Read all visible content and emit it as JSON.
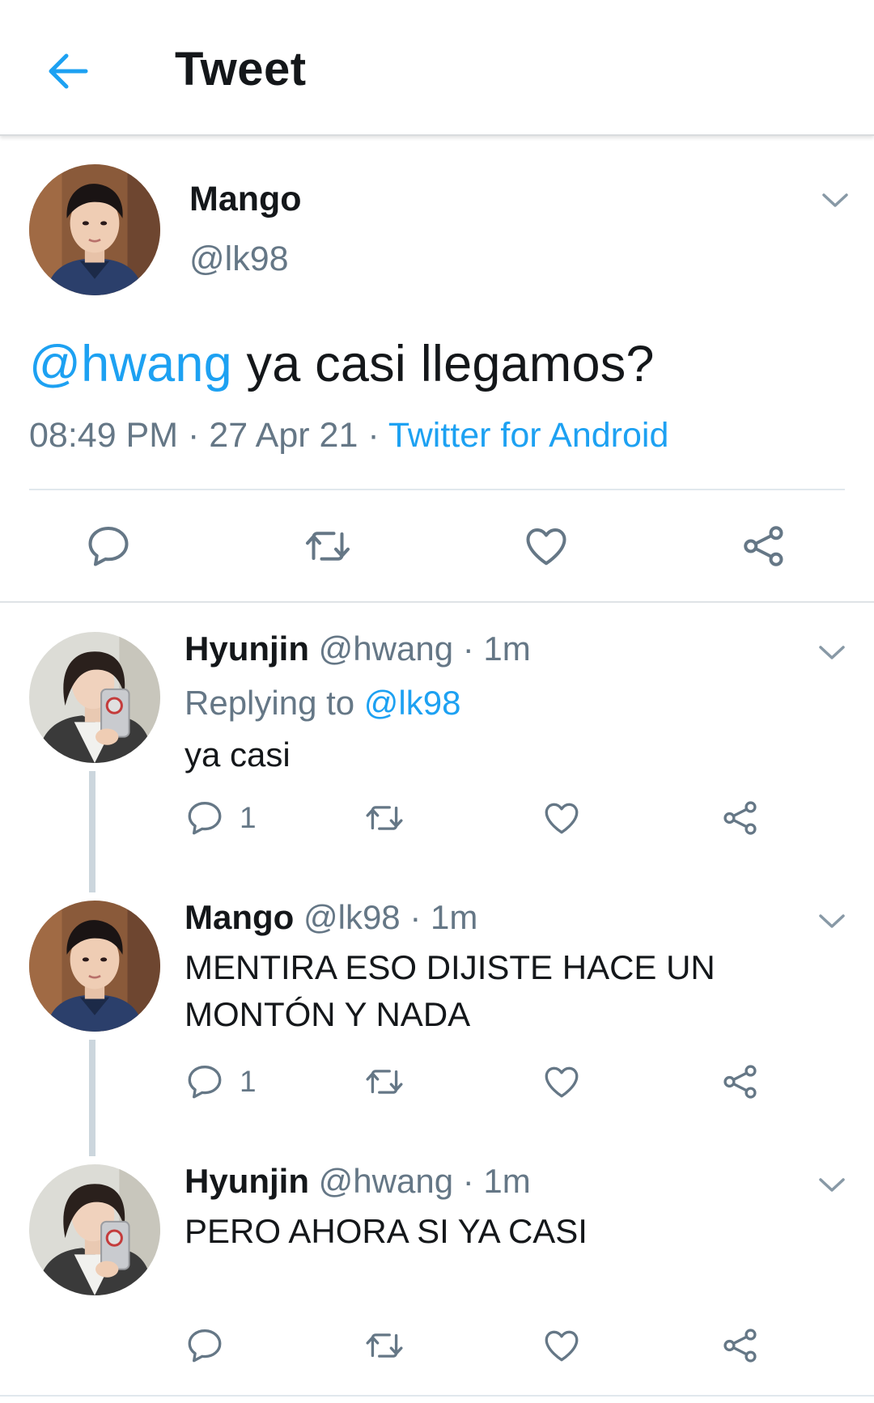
{
  "header": {
    "title": "Tweet",
    "back_icon": "arrow-left-icon"
  },
  "colors": {
    "accent": "#1da1f2",
    "secondary_text": "#657786",
    "primary_text": "#14171a",
    "thread_line": "#ccd6dd"
  },
  "main_tweet": {
    "name": "Mango",
    "handle": "@lk98",
    "mention": "@hwang",
    "text": " ya casi llegamos?",
    "time": "08:49 PM",
    "date": "27 Apr 21",
    "source": "Twitter for Android",
    "meta_separator": " · "
  },
  "replies": [
    {
      "name": "Hyunjin",
      "meta": " @hwang · 1m",
      "replying_label": "Replying to ",
      "replying_handle": "@lk98",
      "text": "ya casi",
      "reply_count": "1"
    },
    {
      "name": "Mango",
      "meta": " @lk98 · 1m",
      "text": "MENTIRA ESO DIJISTE HACE UN MONTÓN Y NADA",
      "reply_count": "1"
    },
    {
      "name": "Hyunjin",
      "meta": " @hwang · 1m",
      "text": "PERO AHORA SI YA CASI",
      "reply_count": ""
    }
  ],
  "icons": [
    "reply-icon",
    "retweet-icon",
    "like-icon",
    "share-icon",
    "chevron-down-icon"
  ]
}
